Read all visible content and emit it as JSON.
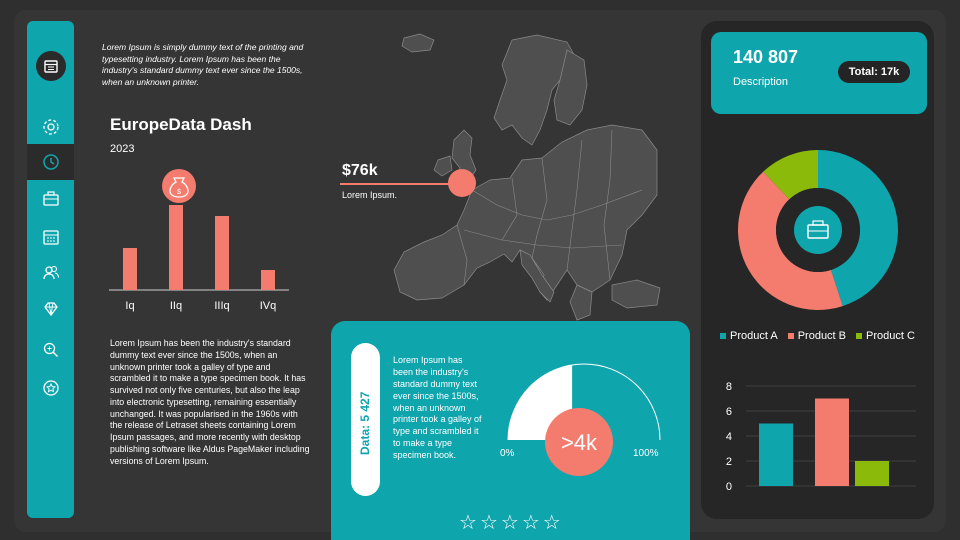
{
  "colors": {
    "teal": "#0fa5ad",
    "coral": "#f47c6e",
    "green": "#8cba0a",
    "dark": "#353535"
  },
  "sidebar": {
    "logo_icon": "calendar-icon",
    "items": [
      {
        "name": "gear-icon"
      },
      {
        "name": "clock-icon",
        "active": true
      },
      {
        "name": "toolbox-icon"
      },
      {
        "name": "calendar-icon"
      },
      {
        "name": "users-icon"
      },
      {
        "name": "diamond-icon"
      },
      {
        "name": "zoom-icon"
      },
      {
        "name": "star-badge-icon"
      }
    ]
  },
  "intro": "Lorem Ipsum is simply dummy text of the printing and typesetting industry. Lorem Ipsum has been the industry's standard dummy text ever since the 1500s, when an unknown printer.",
  "dashboard": {
    "title": "EuropeData Dash",
    "year": "2023"
  },
  "quarter_chart": {
    "icon": "money-bag-icon",
    "categories": [
      "Iq",
      "IIq",
      "IIIq",
      "IVq"
    ],
    "values": [
      42,
      85,
      74,
      20
    ]
  },
  "paragraph": "Lorem Ipsum has been the industry's standard dummy text ever since the 1500s, when an unknown printer took a galley of type and scrambled it to make a type specimen book. It has survived not only five centuries, but also the leap into electronic typesetting, remaining essentially unchanged. It was popularised in the 1960s with the release of Letraset sheets containing Lorem Ipsum passages, and more recently with desktop publishing software like Aldus PageMaker including versions of Lorem Ipsum.",
  "map": {
    "price": "$76k",
    "caption": "Lorem Ipsum."
  },
  "gauge": {
    "data_label": "Data: 5 427",
    "text": "Lorem Ipsum has been the industry's standard dummy text ever since the 1500s, when an unknown printer took a galley of type and scrambled it to make a type specimen book.",
    "value_label": ">4k",
    "min_label": "0%",
    "max_label": "100%",
    "fraction": 0.45,
    "stars": [
      "☆",
      "☆",
      "☆",
      "☆",
      "☆"
    ]
  },
  "stat": {
    "value": "140 807",
    "description": "Description",
    "badge": "Total: 17k"
  },
  "donut": {
    "center_icon": "toolbox-icon",
    "slices": [
      {
        "name": "Product A",
        "value": 45,
        "color": "#0fa5ad"
      },
      {
        "name": "Product B",
        "value": 43,
        "color": "#f47c6e"
      },
      {
        "name": "Product C",
        "value": 12,
        "color": "#8cba0a"
      }
    ]
  },
  "chart_data": {
    "type": "bar",
    "categories": [
      "Product A",
      "Product B",
      "Product C"
    ],
    "values": [
      5,
      7,
      2
    ],
    "colors": [
      "#0fa5ad",
      "#f47c6e",
      "#8cba0a"
    ],
    "yticks": [
      "0",
      "2",
      "4",
      "6",
      "8"
    ],
    "ylim": [
      0,
      8
    ],
    "grid": true
  }
}
